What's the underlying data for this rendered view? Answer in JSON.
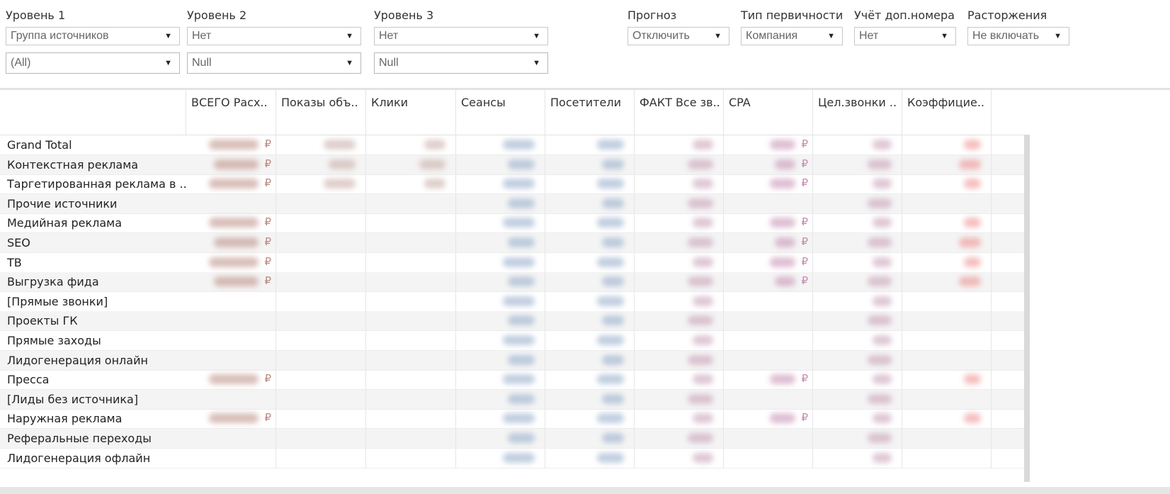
{
  "filters": [
    {
      "label": "Уровень 1",
      "value": "Группа источников",
      "value2": "(All)"
    },
    {
      "label": "Уровень 2",
      "value": "Нет",
      "value2": "Null"
    },
    {
      "label": "Уровень 3",
      "value": "Нет",
      "value2": "Null"
    },
    {
      "label": "Прогноз",
      "value": "Отключить"
    },
    {
      "label": "Тип первичности",
      "value": "Компания"
    },
    {
      "label": "Учёт доп.номера",
      "value": "Нет"
    },
    {
      "label": "Расторжения",
      "value": "Не включать"
    }
  ],
  "columns": [
    "ВСЕГО Расх..",
    "Показы объ..",
    "Клики",
    "Сеансы",
    "Посетители",
    "ФАКТ Все зв..",
    "CPA",
    "Цел.звонки ..",
    "Коэффицие.."
  ],
  "rows": [
    "Grand Total",
    "Контекстная реклама",
    "Таргетированная реклама в ..",
    "Прочие источники",
    "Медийная реклама",
    "SEO",
    "ТВ",
    "Выгрузка фида",
    "[Прямые звонки]",
    "Проекты ГК",
    "Прямые заходы",
    "Лидогенерация онлайн",
    "Пресса",
    "[Лиды без источника]",
    "Наружная реклама",
    "Реферальные переходы",
    "Лидогенерация офлайн"
  ],
  "currency_symbol": "₽",
  "colors": {
    "cost": "#b98a80",
    "impressions": "#c4a8a0",
    "sessions": "#8fa8c8",
    "calls": "#c49ab2",
    "cpa": "#c48ab0",
    "coef": "#ee8a8a"
  },
  "icons": {
    "dropdown": "chevron-down-icon"
  }
}
